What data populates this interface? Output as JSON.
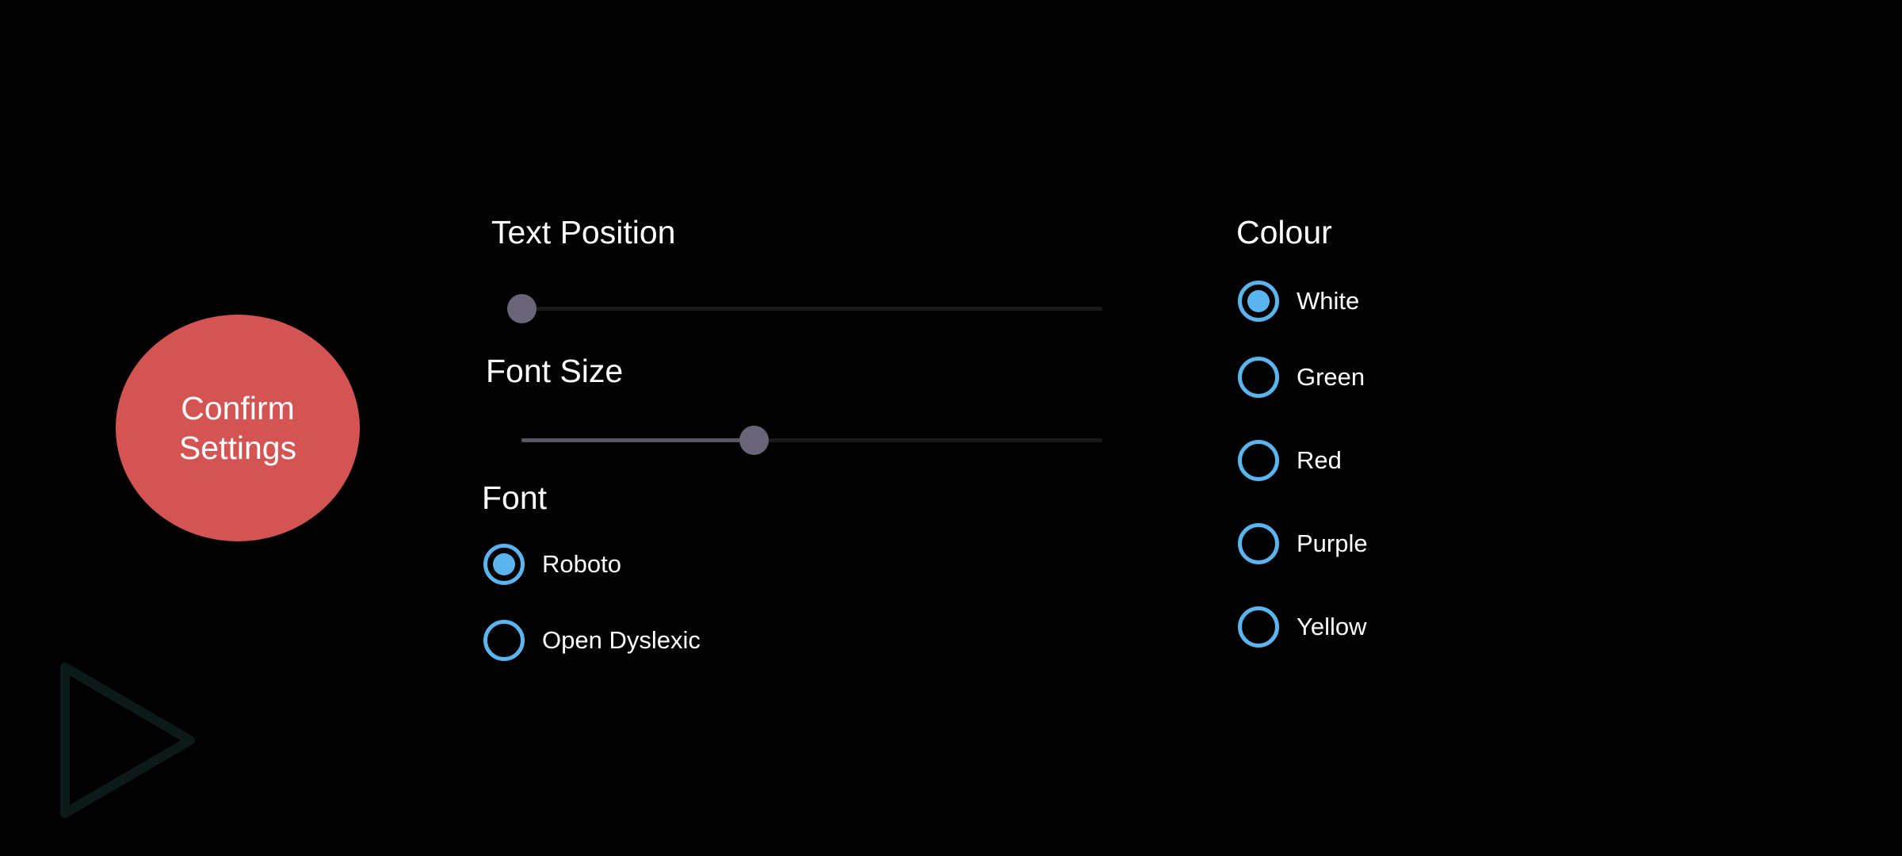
{
  "confirm_button": {
    "label": "Confirm Settings"
  },
  "text_position": {
    "title": "Text Position",
    "value_fraction": 0.0
  },
  "font_size": {
    "title": "Font Size",
    "value_fraction": 0.4
  },
  "font": {
    "title": "Font",
    "options": [
      {
        "label": "Roboto",
        "selected": true
      },
      {
        "label": "Open Dyslexic",
        "selected": false
      }
    ]
  },
  "colour": {
    "title": "Colour",
    "options": [
      {
        "label": "White",
        "selected": true
      },
      {
        "label": "Green",
        "selected": false
      },
      {
        "label": "Red",
        "selected": false
      },
      {
        "label": "Purple",
        "selected": false
      },
      {
        "label": "Yellow",
        "selected": false
      }
    ]
  },
  "colors": {
    "accent": "#5cb4ee",
    "button": "#d45353",
    "slider_thumb": "#6a6478",
    "background": "#000000"
  },
  "icons": {
    "play": "play-triangle-icon"
  }
}
